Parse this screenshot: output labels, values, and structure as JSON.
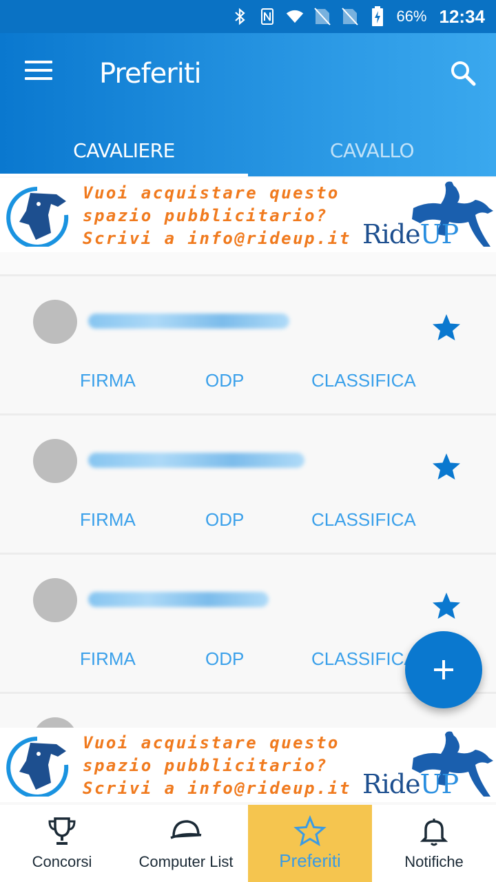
{
  "status_bar": {
    "battery_percent": "66%",
    "time": "12:34",
    "icons": [
      "bluetooth-icon",
      "nfc-icon",
      "wifi-icon",
      "no-sim-icon",
      "no-sim-icon",
      "battery-charging-icon"
    ]
  },
  "app_bar": {
    "title": "Preferiti",
    "tabs": [
      {
        "label": "CAVALIERE",
        "active": true
      },
      {
        "label": "CAVALLO",
        "active": false
      }
    ]
  },
  "ad_banner": {
    "line1": "Vuoi acquistare questo",
    "line2": "spazio pubblicitario?",
    "line3": "Scrivi a info@rideup.it",
    "brand_main": "Ride",
    "brand_accent": "UP"
  },
  "cards": [
    {
      "actions": [
        "FIRMA",
        "ODP",
        "CLASSIFICA"
      ],
      "favorite": true
    },
    {
      "actions": [
        "FIRMA",
        "ODP",
        "CLASSIFICA"
      ],
      "favorite": true
    },
    {
      "actions": [
        "FIRMA",
        "ODP",
        "CLASSIFICA"
      ],
      "favorite": true
    }
  ],
  "bottom_nav": [
    {
      "label": "Concorsi",
      "icon": "trophy-icon",
      "active": false
    },
    {
      "label": "Computer List",
      "icon": "cap-icon",
      "active": false
    },
    {
      "label": "Preferiti",
      "icon": "star-icon",
      "active": true
    },
    {
      "label": "Notifiche",
      "icon": "bell-icon",
      "active": false
    }
  ],
  "colors": {
    "primary": "#0a78cf",
    "accent_text": "#3aa0ea",
    "ad_orange": "#f07a1e",
    "nav_active_bg": "#f5c54f"
  }
}
